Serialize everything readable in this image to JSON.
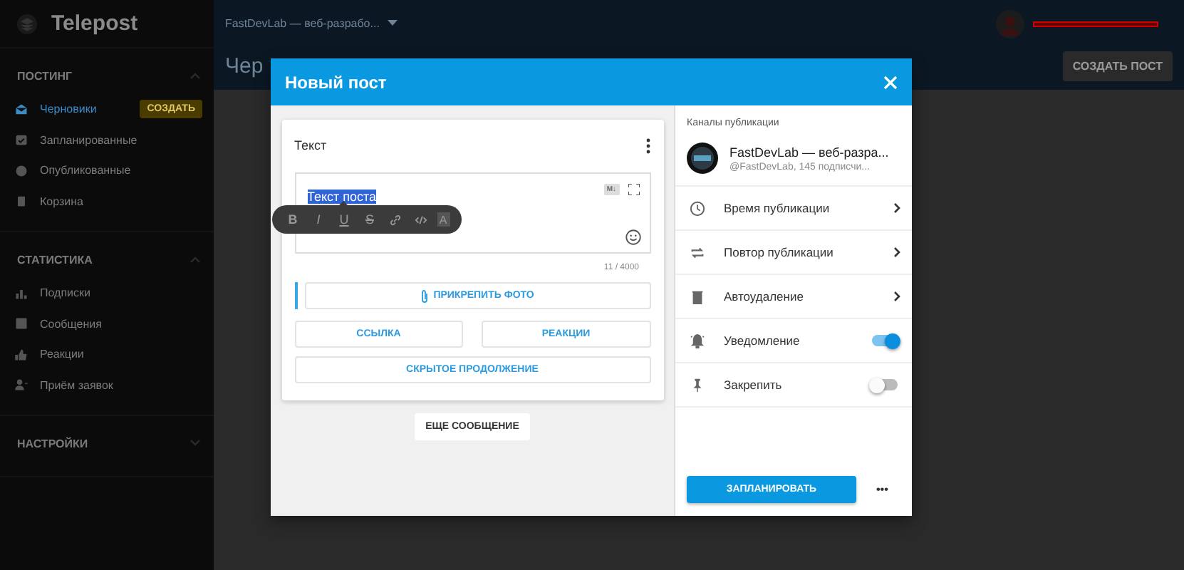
{
  "sidebar": {
    "logo": "Telepost",
    "sections": [
      {
        "title": "ПОСТИНГ",
        "expanded": true,
        "items": [
          {
            "label": "Черновики",
            "selected": true,
            "badge": "СОЗДАТЬ"
          },
          {
            "label": "Запланированные",
            "selected": false
          },
          {
            "label": "Опубликованные",
            "selected": false
          },
          {
            "label": "Корзина",
            "selected": false
          }
        ]
      },
      {
        "title": "СТАТИСТИКА",
        "expanded": true,
        "items": [
          {
            "label": "Подписки",
            "selected": false
          },
          {
            "label": "Сообщения",
            "selected": false
          },
          {
            "label": "Реакции",
            "selected": false
          },
          {
            "label": "Приём заявок",
            "selected": false
          }
        ]
      },
      {
        "title": "НАСТРОЙКИ",
        "expanded": false
      }
    ]
  },
  "header": {
    "channel": "FastDevLab — веб-разрабо...",
    "page_title": "Чер",
    "create_button": "СОЗДАТЬ ПОСТ"
  },
  "modal": {
    "title": "Новый пост",
    "editor": {
      "title": "Текст",
      "text": "Текст поста",
      "markdown_badge": "M↓",
      "counter": "11 / 4000",
      "toolbar": [
        {
          "kind": "bold",
          "label": "B"
        },
        {
          "kind": "italic",
          "label": "I"
        },
        {
          "kind": "underline",
          "label": "U"
        },
        {
          "kind": "strike",
          "label": "S"
        },
        {
          "kind": "link"
        },
        {
          "kind": "code"
        },
        {
          "kind": "clear",
          "label": "A"
        }
      ],
      "attach_button": "ПРИКРЕПИТЬ ФОТО",
      "buttons": [
        {
          "label": "ССЫЛКА"
        },
        {
          "label": "РЕАКЦИИ"
        },
        {
          "label": "СКРЫТОЕ ПРОДОЛЖЕНИЕ"
        }
      ]
    },
    "more_message_button": "ЕЩЕ СООБЩЕНИЕ",
    "channels_title": "Каналы публикации",
    "channel": {
      "name": "FastDevLab — веб-разра...",
      "subtitle": "@FastDevLab, 145 подписчи..."
    },
    "settings": [
      {
        "kind": "nav",
        "label": "Время публикации"
      },
      {
        "kind": "nav",
        "label": "Повтор публикации"
      },
      {
        "kind": "nav",
        "label": "Автоудаление"
      },
      {
        "kind": "toggle",
        "label": "Уведомление",
        "on": true
      },
      {
        "kind": "toggle",
        "label": "Закрепить",
        "on": false
      }
    ],
    "schedule_button": "ЗАПЛАНИРОВАТЬ",
    "more_button": "•••"
  }
}
